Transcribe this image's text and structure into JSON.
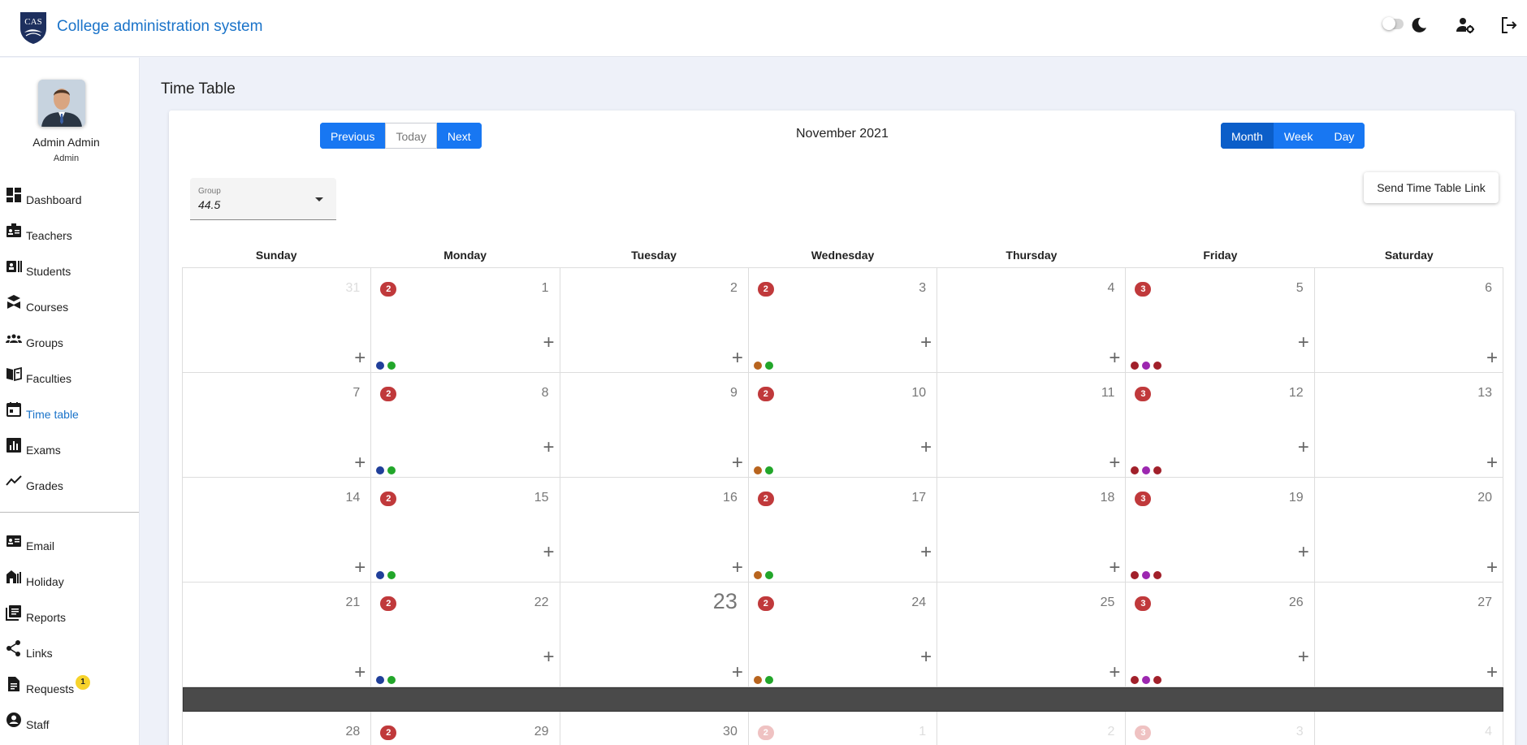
{
  "app": {
    "title": "College administration system",
    "logo_text": "CAS"
  },
  "user": {
    "name": "Admin Admin",
    "role": "Admin"
  },
  "sidebar": {
    "items": [
      {
        "label": "Dashboard",
        "icon": "dashboard-icon"
      },
      {
        "label": "Teachers",
        "icon": "teachers-icon"
      },
      {
        "label": "Students",
        "icon": "students-icon"
      },
      {
        "label": "Courses",
        "icon": "courses-icon"
      },
      {
        "label": "Groups",
        "icon": "groups-icon"
      },
      {
        "label": "Faculties",
        "icon": "faculties-icon"
      },
      {
        "label": "Time table",
        "icon": "calendar-icon",
        "active": true
      },
      {
        "label": "Exams",
        "icon": "exams-icon"
      },
      {
        "label": "Grades",
        "icon": "grades-icon"
      }
    ],
    "secondary": [
      {
        "label": "Email",
        "icon": "email-icon"
      },
      {
        "label": "Holiday",
        "icon": "holiday-icon"
      },
      {
        "label": "Reports",
        "icon": "reports-icon"
      },
      {
        "label": "Links",
        "icon": "share-icon"
      },
      {
        "label": "Requests",
        "icon": "requests-icon",
        "badge": "1"
      },
      {
        "label": "Staff",
        "icon": "staff-icon"
      }
    ]
  },
  "page": {
    "title": "Time Table"
  },
  "toolbar": {
    "previous": "Previous",
    "today": "Today",
    "next": "Next",
    "current_month": "November 2021",
    "month": "Month",
    "week": "Week",
    "day": "Day",
    "send_link": "Send Time Table Link"
  },
  "group_select": {
    "label": "Group",
    "value": "44.5"
  },
  "colors": {
    "accent": "#1877f2",
    "badge_red": "#c0393b",
    "dot_blue": "#203f9a",
    "dot_green": "#22a62a",
    "dot_orange": "#b8641e",
    "dot_darkred": "#a1202a",
    "dot_purple": "#9c27b0"
  },
  "calendar": {
    "weekdays": [
      "Sunday",
      "Monday",
      "Tuesday",
      "Wednesday",
      "Thursday",
      "Friday",
      "Saturday"
    ],
    "weeks": [
      [
        {
          "day": "31",
          "other_month": true
        },
        {
          "day": "1",
          "count": "2",
          "dots": [
            "dot_blue",
            "dot_green"
          ]
        },
        {
          "day": "2"
        },
        {
          "day": "3",
          "count": "2",
          "dots": [
            "dot_orange",
            "dot_green"
          ]
        },
        {
          "day": "4"
        },
        {
          "day": "5",
          "count": "3",
          "dots": [
            "dot_darkred",
            "dot_purple",
            "dot_darkred"
          ]
        },
        {
          "day": "6"
        }
      ],
      [
        {
          "day": "7"
        },
        {
          "day": "8",
          "count": "2",
          "dots": [
            "dot_blue",
            "dot_green"
          ]
        },
        {
          "day": "9"
        },
        {
          "day": "10",
          "count": "2",
          "dots": [
            "dot_orange",
            "dot_green"
          ]
        },
        {
          "day": "11"
        },
        {
          "day": "12",
          "count": "3",
          "dots": [
            "dot_darkred",
            "dot_purple",
            "dot_darkred"
          ]
        },
        {
          "day": "13"
        }
      ],
      [
        {
          "day": "14"
        },
        {
          "day": "15",
          "count": "2",
          "dots": [
            "dot_blue",
            "dot_green"
          ]
        },
        {
          "day": "16"
        },
        {
          "day": "17",
          "count": "2",
          "dots": [
            "dot_orange",
            "dot_green"
          ]
        },
        {
          "day": "18"
        },
        {
          "day": "19",
          "count": "3",
          "dots": [
            "dot_darkred",
            "dot_purple",
            "dot_darkred"
          ]
        },
        {
          "day": "20"
        }
      ],
      [
        {
          "day": "21"
        },
        {
          "day": "22",
          "count": "2",
          "dots": [
            "dot_blue",
            "dot_green"
          ]
        },
        {
          "day": "23",
          "today": true
        },
        {
          "day": "24",
          "count": "2",
          "dots": [
            "dot_orange",
            "dot_green"
          ]
        },
        {
          "day": "25"
        },
        {
          "day": "26",
          "count": "3",
          "dots": [
            "dot_darkred",
            "dot_purple",
            "dot_darkred"
          ]
        },
        {
          "day": "27"
        }
      ],
      [
        {
          "day": "28"
        },
        {
          "day": "29",
          "count": "2"
        },
        {
          "day": "30"
        },
        {
          "day": "1",
          "count": "2",
          "other_month": true
        },
        {
          "day": "2",
          "other_month": true
        },
        {
          "day": "3",
          "count": "3",
          "other_month": true
        },
        {
          "day": "4",
          "other_month": true
        }
      ]
    ]
  }
}
